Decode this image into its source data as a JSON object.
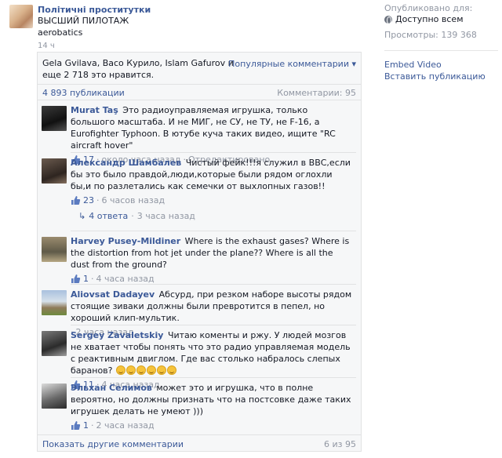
{
  "post": {
    "page_name": "Політичні проститутки",
    "text_line1": "ВЫСШИЙ ПИЛОТАЖ",
    "text_line2": "aerobatics",
    "time": "14 ч"
  },
  "sidebar": {
    "published_label": "Опубликовано для:",
    "audience": "Доступно всем",
    "views": "Просмотры: 139 368",
    "embed_label": "Embed Video",
    "insert_label": "Вставить публикацию"
  },
  "likes": {
    "text": "Gela Gvilava, Васо Курило, Islam Gafurov и еще 2 718 это нравится."
  },
  "sort": {
    "label": "Популярные комментарии ▾"
  },
  "stats": {
    "shares": "4 893 публикации",
    "comments": "Комментарии: 95"
  },
  "comments": [
    {
      "author": "Murat Taş",
      "text": "Это радиоуправляемая игрушка, только большого масштаба. И не МИГ, не СУ, не ТУ, не F-16, а Eurofighter Typhoon. В ютубе куча таких видео, ищите \"RC aircraft hover\"",
      "likes": "17",
      "time": "около часа назад",
      "extra": "Отредактировано"
    },
    {
      "author": "Александр Шамбалев",
      "text": "Чистый фейк!!!я служил в ВВС,если бы это было правдой,люди,которые были рядом оглохли бы,и по разлетались как семечки от выхлопных газов!!",
      "likes": "23",
      "time": "6 часов назад",
      "replies": "4 ответа",
      "replies_time": "3 часа назад"
    },
    {
      "author": "Harvey Pusey-Mildiner",
      "text": "Where is the exhaust gases? Where is the distortion from hot jet under the plane?? Where is all the dust from the ground?",
      "likes": "1",
      "time": "4 часа назад"
    },
    {
      "author": "Aliovsat Dadayev",
      "text": "Абсурд, при резком наборе высоты рядом стоящие зиваки должны были превротится в пепел, но хороший клип-мультик.",
      "time": "2 часа назад"
    },
    {
      "author": "Sergey Zavaletskiy",
      "text": "Читаю коменты и ржу. У людей мозгов не хватает чтобы понять что это радио управляемая модель с реактивным двиглом. Где вас столько набралось слепых баранов?",
      "emoji_count": 6,
      "likes": "11",
      "time": "4 часа назад"
    },
    {
      "author": "Эльхан Селимов",
      "text": "может это и игрушка, что в полне вероятно, но должны признать что на постсовке даже таких игрушек делать не умеют )))",
      "likes": "1",
      "time": "2 часа назад"
    }
  ],
  "footer": {
    "more_label": "Показать другие комментарии",
    "count": "6 из 95"
  },
  "icons": {
    "globe": "globe-icon",
    "like": "thumbs-up-icon",
    "reply": "reply-arrow-icon",
    "smile": "smile-emoji-icon"
  },
  "colors": {
    "link": "#3b5998",
    "muted": "#9197a3",
    "panel_bg": "#f6f7f8"
  }
}
